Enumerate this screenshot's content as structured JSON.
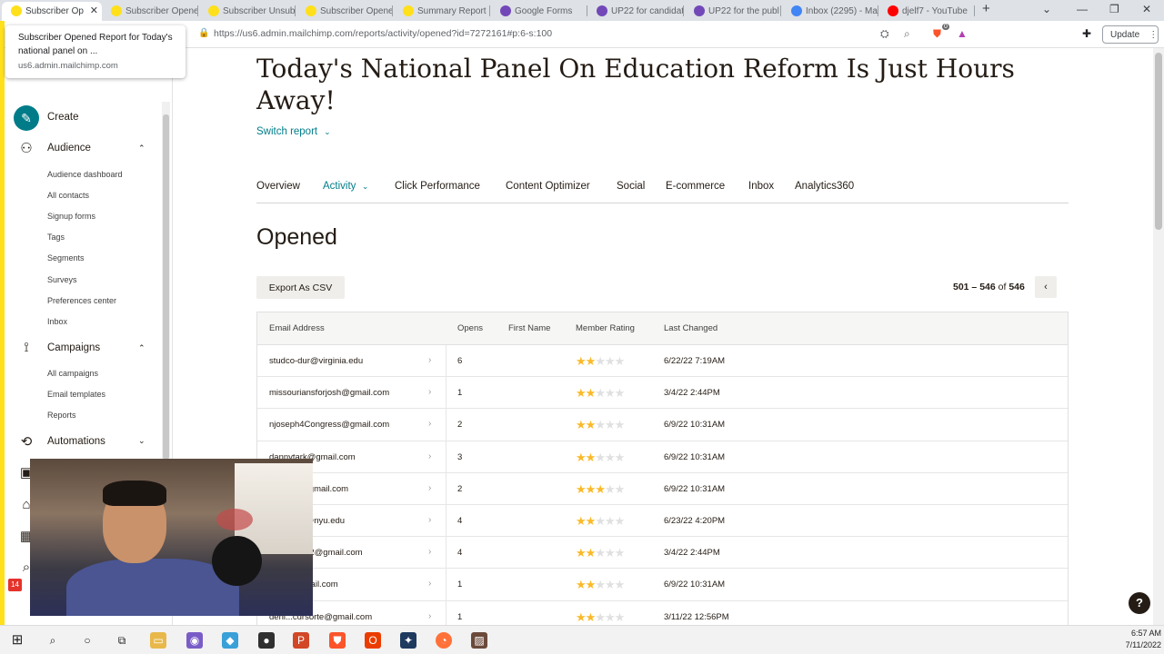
{
  "browser": {
    "tabs": [
      {
        "label": "Subscriber Op",
        "active": true
      },
      {
        "label": "Subscriber Opene"
      },
      {
        "label": "Subscriber Unsub"
      },
      {
        "label": "Subscriber Opene"
      },
      {
        "label": "Summary Report"
      },
      {
        "label": "Google Forms"
      },
      {
        "label": "UP22 for candidat"
      },
      {
        "label": "UP22 for the publ"
      },
      {
        "label": "Inbox (2295) - Ma"
      },
      {
        "label": "djelf7 - YouTube"
      }
    ],
    "url": "https://us6.admin.mailchimp.com/reports/activity/opened?id=7272161#p:6-s:100",
    "update_label": "Update",
    "tooltip": {
      "title": "Subscriber Opened Report for Today's national panel on ...",
      "host": "us6.admin.mailchimp.com"
    },
    "shield_count": "0"
  },
  "sidebar": {
    "create": "Create",
    "audience": "Audience",
    "audience_items": [
      "Audience dashboard",
      "All contacts",
      "Signup forms",
      "Tags",
      "Segments",
      "Surveys",
      "Preferences center",
      "Inbox"
    ],
    "campaigns": "Campaigns",
    "campaign_items": [
      "All campaigns",
      "Email templates",
      "Reports"
    ],
    "automations": "Automations",
    "badge": "14"
  },
  "report": {
    "title": "Today's National Panel On Education Reform Is Just Hours Away!",
    "switch_report": "Switch report",
    "tabs": [
      "Overview",
      "Activity",
      "Click Performance",
      "Content Optimizer",
      "Social",
      "E-commerce",
      "Inbox",
      "Analytics360"
    ],
    "section_title": "Opened",
    "export_label": "Export As CSV",
    "pager": {
      "range": "501 – 546",
      "of": "of",
      "total": "546"
    },
    "columns": [
      "Email Address",
      "Opens",
      "First Name",
      "Member Rating",
      "Last Changed"
    ],
    "rows": [
      {
        "email": "studco-dur@virginia.edu",
        "opens": "6",
        "first_name": "",
        "rating": 2,
        "changed": "6/22/22 7:19AM"
      },
      {
        "email": "missouriansforjosh@gmail.com",
        "opens": "1",
        "first_name": "",
        "rating": 2,
        "changed": "3/4/22 2:44PM"
      },
      {
        "email": "njoseph4Congress@gmail.com",
        "opens": "2",
        "first_name": "",
        "rating": 2,
        "changed": "6/9/22 10:31AM"
      },
      {
        "email": "dannytark@gmail.com",
        "opens": "3",
        "first_name": "",
        "rating": 2,
        "changed": "6/9/22 10:31AM"
      },
      {
        "email": "ree2011@gmail.com",
        "opens": "2",
        "first_name": "",
        "rating": 3,
        "changed": "6/9/22 10:31AM"
      },
      {
        "email": "vernment@nyu.edu",
        "opens": "4",
        "first_name": "",
        "rating": 2,
        "changed": "6/23/22 4:20PM"
      },
      {
        "email": "merica2022@gmail.com",
        "opens": "4",
        "first_name": "",
        "rating": 2,
        "changed": "3/4/22 2:44PM"
      },
      {
        "email": "tsguy@gmail.com",
        "opens": "1",
        "first_name": "",
        "rating": 2,
        "changed": "6/9/22 10:31AM"
      },
      {
        "email": "deni...cursorte@gmail.com",
        "opens": "1",
        "first_name": "",
        "rating": 2,
        "changed": "3/11/22 12:56PM"
      }
    ]
  },
  "taskbar": {
    "time": "6:57 AM",
    "date": "7/11/2022"
  },
  "colors": {
    "accent": "#007c89",
    "brand_yellow": "#ffe01b",
    "star": "#fbb928"
  }
}
